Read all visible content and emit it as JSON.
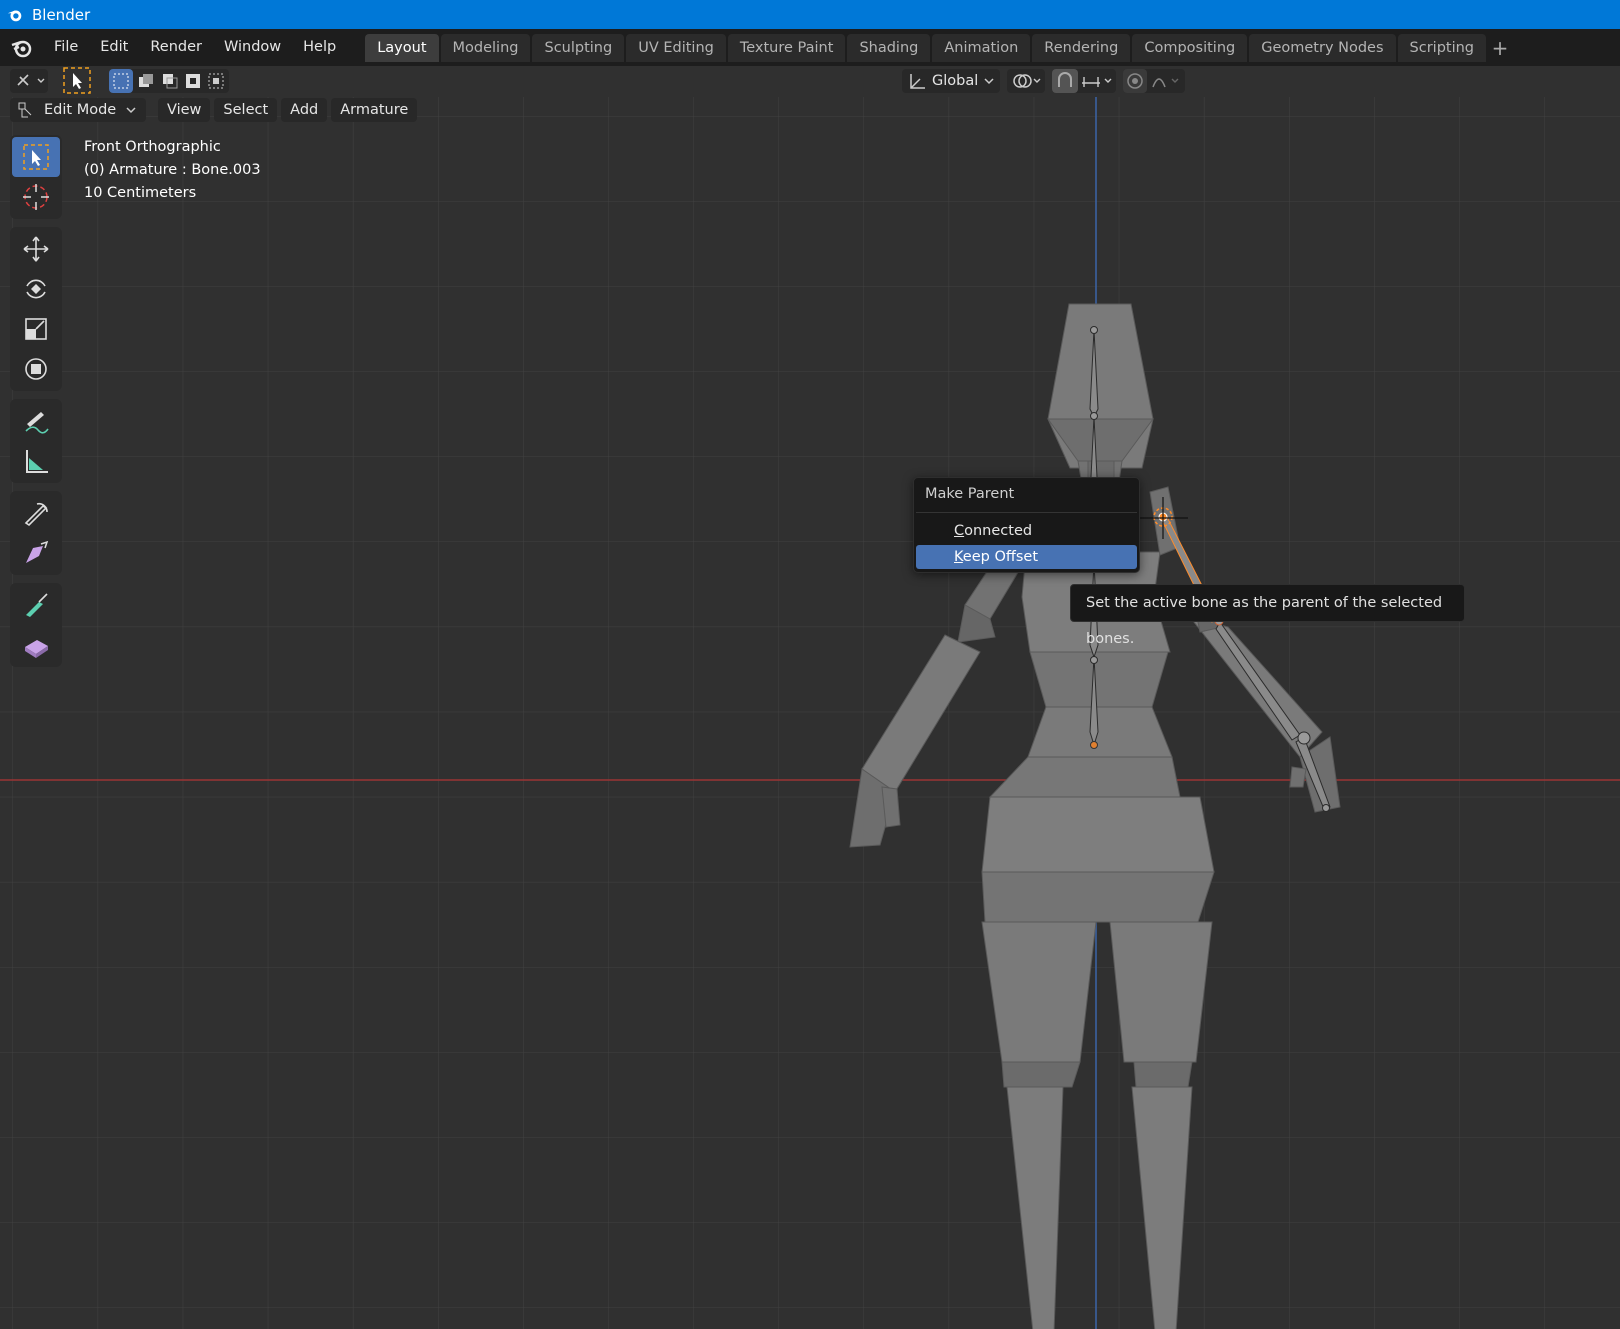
{
  "window": {
    "title": "Blender"
  },
  "menu": [
    "File",
    "Edit",
    "Render",
    "Window",
    "Help"
  ],
  "workspaces": [
    {
      "label": "Layout",
      "active": true
    },
    {
      "label": "Modeling"
    },
    {
      "label": "Sculpting"
    },
    {
      "label": "UV Editing"
    },
    {
      "label": "Texture Paint"
    },
    {
      "label": "Shading"
    },
    {
      "label": "Animation"
    },
    {
      "label": "Rendering"
    },
    {
      "label": "Compositing"
    },
    {
      "label": "Geometry Nodes"
    },
    {
      "label": "Scripting"
    }
  ],
  "header": {
    "orientation": "Global"
  },
  "viewport_header": {
    "mode": "Edit Mode",
    "menus": [
      "View",
      "Select",
      "Add",
      "Armature"
    ]
  },
  "overlay": {
    "view": "Front Orthographic",
    "object": "(0) Armature : Bone.003",
    "scale": "10 Centimeters"
  },
  "popup": {
    "title": "Make Parent",
    "items": [
      {
        "label": "Connected",
        "underline": "C"
      },
      {
        "label": "Keep Offset",
        "underline": "K",
        "highlighted": true
      }
    ]
  },
  "tooltip": "Set the active bone as the parent of the selected bones.",
  "colors": {
    "accent": "#4772b3",
    "titlebar": "#0078d7",
    "x_axis": "#a33a3a",
    "z_axis": "#3d6ab0",
    "selection": "#ff8c2a"
  }
}
